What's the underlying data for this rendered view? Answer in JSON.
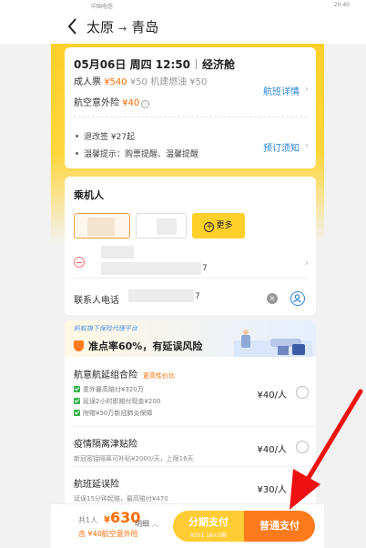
{
  "status_bar": {
    "carrier": "中国电信",
    "time": "20:40"
  },
  "header": {
    "from": "太原",
    "arrow": "→",
    "to": "青岛"
  },
  "flight": {
    "date": "05月06日 周四 12:50",
    "cabin": "经济舱",
    "ticket_type": "成人票",
    "price": "¥540",
    "fuel": "¥50 机建燃油 ¥50",
    "detail_link": "航班详情",
    "insurance": "航空意外险",
    "insurance_price": "¥40",
    "rule1": "退改签 ¥27起",
    "rule2": "温馨提示：购票提醒、温馨提醒",
    "notice_link": "预订须知"
  },
  "passenger": {
    "title": "乘机人",
    "more_label": "更多",
    "id_suffix": "7",
    "contact_label": "联系人电话",
    "phone_suffix": "7"
  },
  "insurance_section": {
    "platform": "蚂蚁旗下保险代理平台",
    "headline": "准点率60%，有延误风险",
    "items": [
      {
        "name": "航意航延组合险",
        "tag": "更高性价比",
        "price": "¥40/人",
        "features": [
          "意外最高赔付¥320万",
          "延误2小时即赔付现金¥200",
          "附赠¥50万新冠肺炎保障"
        ]
      },
      {
        "name": "疫情隔离津贴险",
        "price": "¥40/人",
        "desc": "新冠密接隔离可补贴¥2000/天，上限16天"
      },
      {
        "name": "航班延误险",
        "price": "¥30/人",
        "desc": "延误15分钟起赔，最高赔付¥470"
      }
    ]
  },
  "bottom": {
    "count": "共1人",
    "total": "630",
    "currency": "¥",
    "insurance_note": "含 ¥40航空意外险",
    "detail": "明细",
    "split_pay": "分期支付",
    "split_sub": "¥201.18×3期",
    "pay": "普通支付"
  }
}
